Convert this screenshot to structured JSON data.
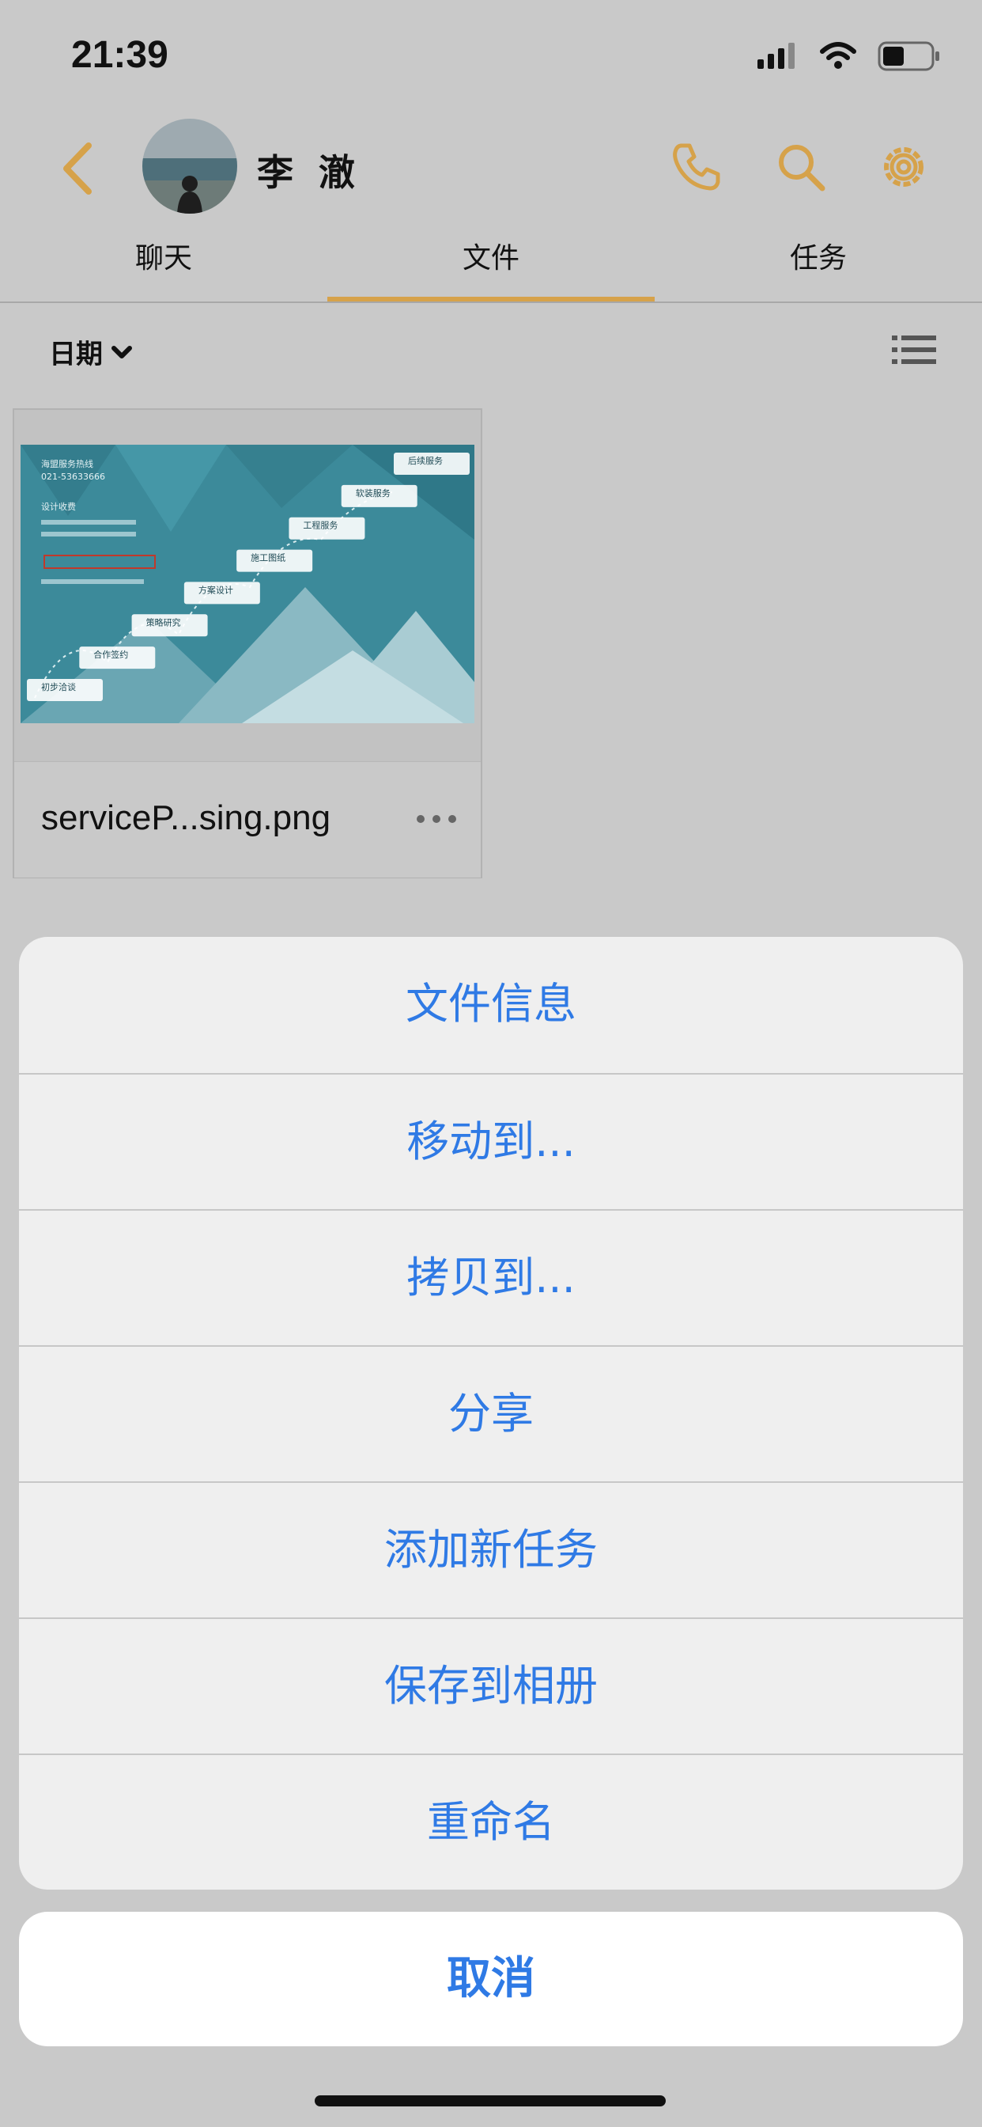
{
  "status_bar": {
    "time": "21:39",
    "battery_level": 0.45
  },
  "header": {
    "contact_name": "李 澈",
    "icons": [
      "back-chevron-icon",
      "phone-icon",
      "search-icon",
      "gear-icon"
    ],
    "accent_color": "#d6a24a"
  },
  "tabs": [
    {
      "label": "聊天",
      "active": false
    },
    {
      "label": "文件",
      "active": true
    },
    {
      "label": "任务",
      "active": false
    }
  ],
  "filter": {
    "sort_label": "日期",
    "sort_icon": "chevron-down-icon",
    "view_icon": "list-view-icon"
  },
  "file": {
    "name": "serviceP...sing.png",
    "thumb_steps": [
      "初步洽谈",
      "合作签约",
      "策略研究",
      "方案设计",
      "施工图纸",
      "工程服务",
      "软装服务",
      "后续服务"
    ],
    "thumb_header": [
      "海盟服务热线",
      "021-53633666",
      "设计收费"
    ]
  },
  "action_sheet": {
    "items": [
      "文件信息",
      "移动到...",
      "拷贝到...",
      "分享",
      "添加新任务",
      "保存到相册",
      "重命名"
    ],
    "cancel_label": "取消",
    "item_color": "#2f7ae5"
  }
}
